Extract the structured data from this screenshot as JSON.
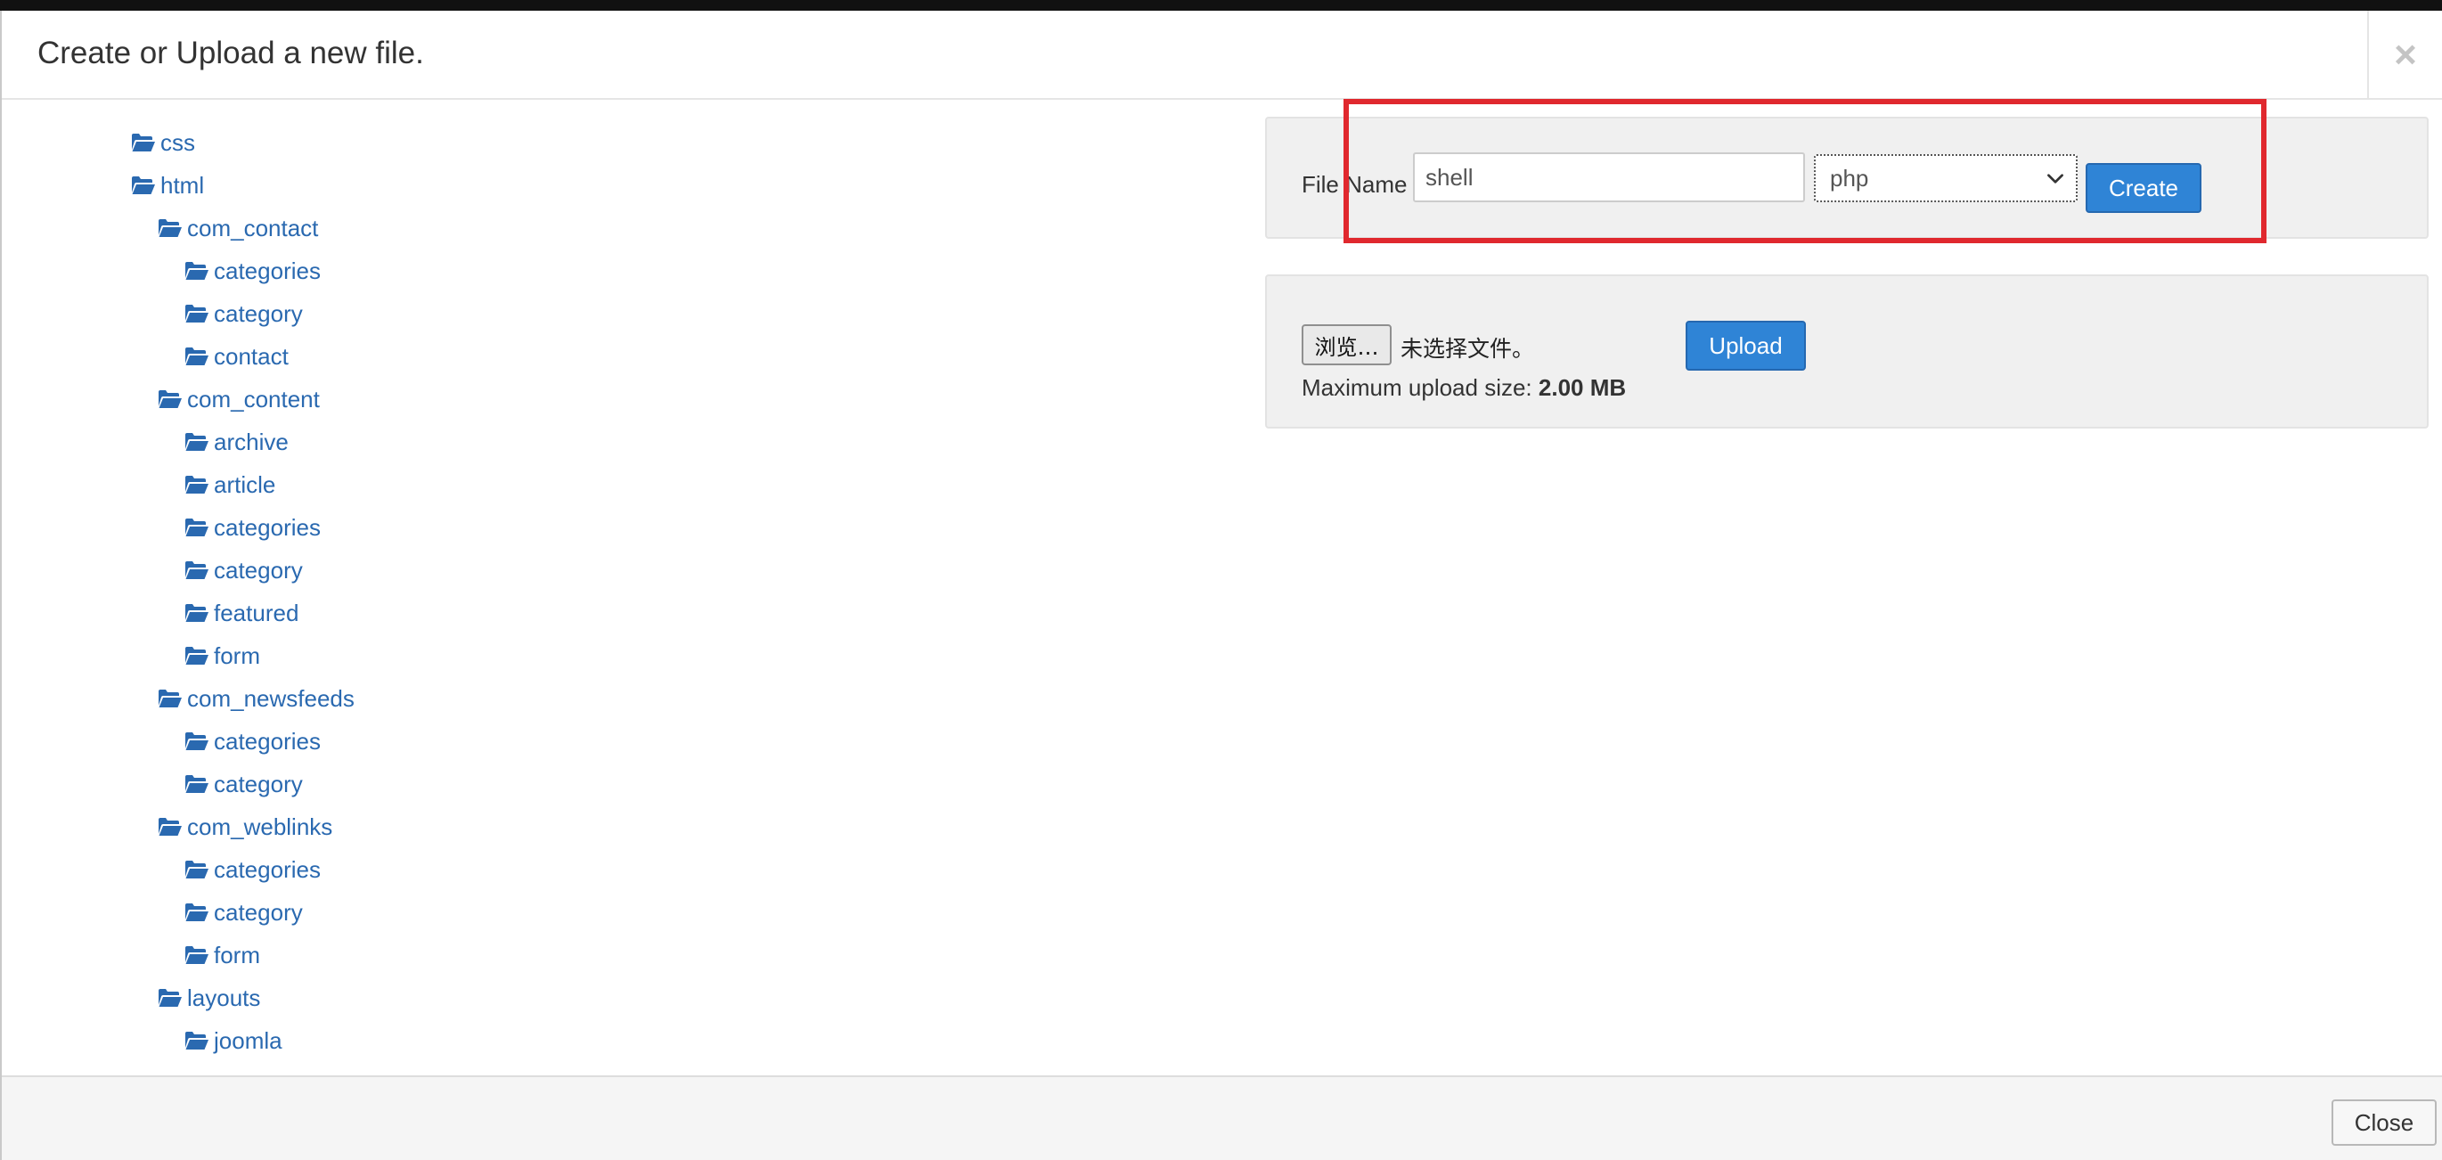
{
  "modal": {
    "title": "Create or Upload a new file.",
    "close_symbol": "×"
  },
  "tree": {
    "items": [
      {
        "label": "css",
        "icon": "folder-open-icon"
      },
      {
        "label": "html",
        "icon": "folder-open-icon"
      },
      {
        "label": "com_contact",
        "icon": "folder-open-icon"
      },
      {
        "label": "categories",
        "icon": "folder-open-icon"
      },
      {
        "label": "category",
        "icon": "folder-open-icon"
      },
      {
        "label": "contact",
        "icon": "folder-open-icon"
      },
      {
        "label": "com_content",
        "icon": "folder-open-icon"
      },
      {
        "label": "archive",
        "icon": "folder-open-icon"
      },
      {
        "label": "article",
        "icon": "folder-open-icon"
      },
      {
        "label": "categories",
        "icon": "folder-open-icon"
      },
      {
        "label": "category",
        "icon": "folder-open-icon"
      },
      {
        "label": "featured",
        "icon": "folder-open-icon"
      },
      {
        "label": "form",
        "icon": "folder-open-icon"
      },
      {
        "label": "com_newsfeeds",
        "icon": "folder-open-icon"
      },
      {
        "label": "categories",
        "icon": "folder-open-icon"
      },
      {
        "label": "category",
        "icon": "folder-open-icon"
      },
      {
        "label": "com_weblinks",
        "icon": "folder-open-icon"
      },
      {
        "label": "categories",
        "icon": "folder-open-icon"
      },
      {
        "label": "category",
        "icon": "folder-open-icon"
      },
      {
        "label": "form",
        "icon": "folder-open-icon"
      },
      {
        "label": "layouts",
        "icon": "folder-open-icon"
      },
      {
        "label": "joomla",
        "icon": "folder-open-icon"
      }
    ]
  },
  "create_form": {
    "label": "File Name",
    "filename_value": "shell",
    "type_selected": "php",
    "create_label": "Create"
  },
  "upload_form": {
    "browse_label": "浏览…",
    "no_file_text": "未选择文件。",
    "upload_label": "Upload",
    "max_size_label": "Maximum upload size:",
    "max_size_value": "2.00 MB"
  },
  "footer": {
    "close_label": "Close"
  },
  "colors": {
    "link": "#2a69b0",
    "primary_button": "#2f84d6",
    "highlight": "#e0282e",
    "panel_bg": "#f0f0f0"
  }
}
